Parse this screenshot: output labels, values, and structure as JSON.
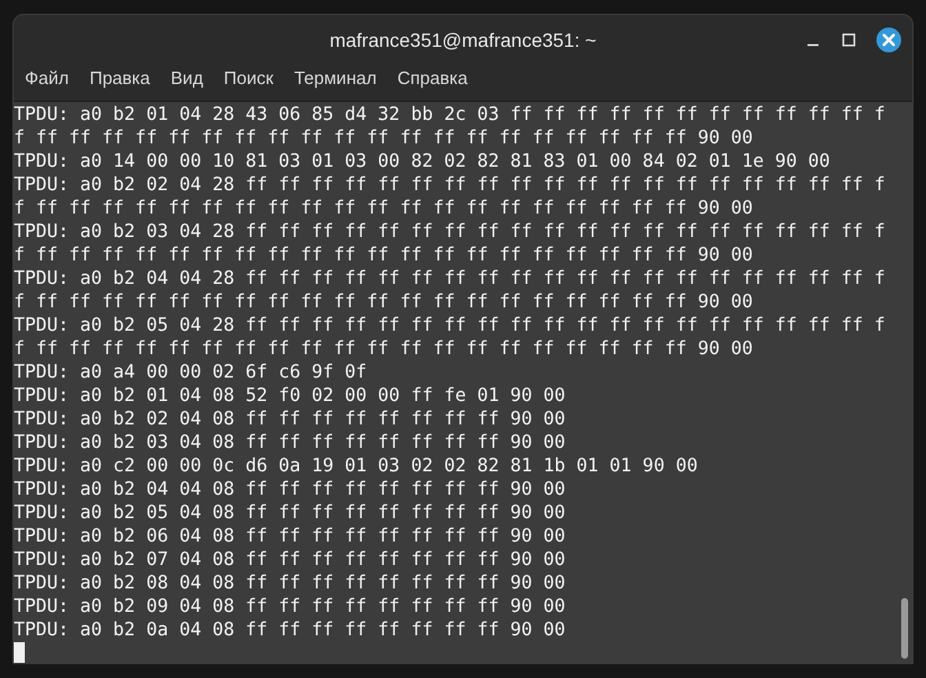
{
  "window": {
    "title": "mafrance351@mafrance351: ~"
  },
  "menu": [
    {
      "label": "Файл"
    },
    {
      "label": "Правка"
    },
    {
      "label": "Вид"
    },
    {
      "label": "Поиск"
    },
    {
      "label": "Терминал"
    },
    {
      "label": "Справка"
    }
  ],
  "terminal": {
    "lines": [
      "TPDU: a0 b2 01 04 28 43 06 85 d4 32 bb 2c 03 ff ff ff ff ff ff ff ff ff ff ff ff ff ff ff ff ff ff ff ff ff ff ff ff ff ff ff ff ff ff ff ff 90 00",
      "TPDU: a0 14 00 00 10 81 03 01 03 00 82 02 82 81 83 01 00 84 02 01 1e 90 00",
      "TPDU: a0 b2 02 04 28 ff ff ff ff ff ff ff ff ff ff ff ff ff ff ff ff ff ff ff ff ff ff ff ff ff ff ff ff ff ff ff ff ff ff ff ff ff ff ff ff 90 00",
      "TPDU: a0 b2 03 04 28 ff ff ff ff ff ff ff ff ff ff ff ff ff ff ff ff ff ff ff ff ff ff ff ff ff ff ff ff ff ff ff ff ff ff ff ff ff ff ff ff 90 00",
      "TPDU: a0 b2 04 04 28 ff ff ff ff ff ff ff ff ff ff ff ff ff ff ff ff ff ff ff ff ff ff ff ff ff ff ff ff ff ff ff ff ff ff ff ff ff ff ff ff 90 00",
      "TPDU: a0 b2 05 04 28 ff ff ff ff ff ff ff ff ff ff ff ff ff ff ff ff ff ff ff ff ff ff ff ff ff ff ff ff ff ff ff ff ff ff ff ff ff ff ff ff 90 00",
      "TPDU: a0 a4 00 00 02 6f c6 9f 0f",
      "TPDU: a0 b2 01 04 08 52 f0 02 00 00 ff fe 01 90 00",
      "TPDU: a0 b2 02 04 08 ff ff ff ff ff ff ff ff 90 00",
      "TPDU: a0 b2 03 04 08 ff ff ff ff ff ff ff ff 90 00",
      "TPDU: a0 c2 00 00 0c d6 0a 19 01 03 02 02 82 81 1b 01 01 90 00",
      "TPDU: a0 b2 04 04 08 ff ff ff ff ff ff ff ff 90 00",
      "TPDU: a0 b2 05 04 08 ff ff ff ff ff ff ff ff 90 00",
      "TPDU: a0 b2 06 04 08 ff ff ff ff ff ff ff ff 90 00",
      "TPDU: a0 b2 07 04 08 ff ff ff ff ff ff ff ff 90 00",
      "TPDU: a0 b2 08 04 08 ff ff ff ff ff ff ff ff 90 00",
      "TPDU: a0 b2 09 04 08 ff ff ff ff ff ff ff ff 90 00",
      "TPDU: a0 b2 0a 04 08 ff ff ff ff ff ff ff ff 90 00"
    ]
  }
}
